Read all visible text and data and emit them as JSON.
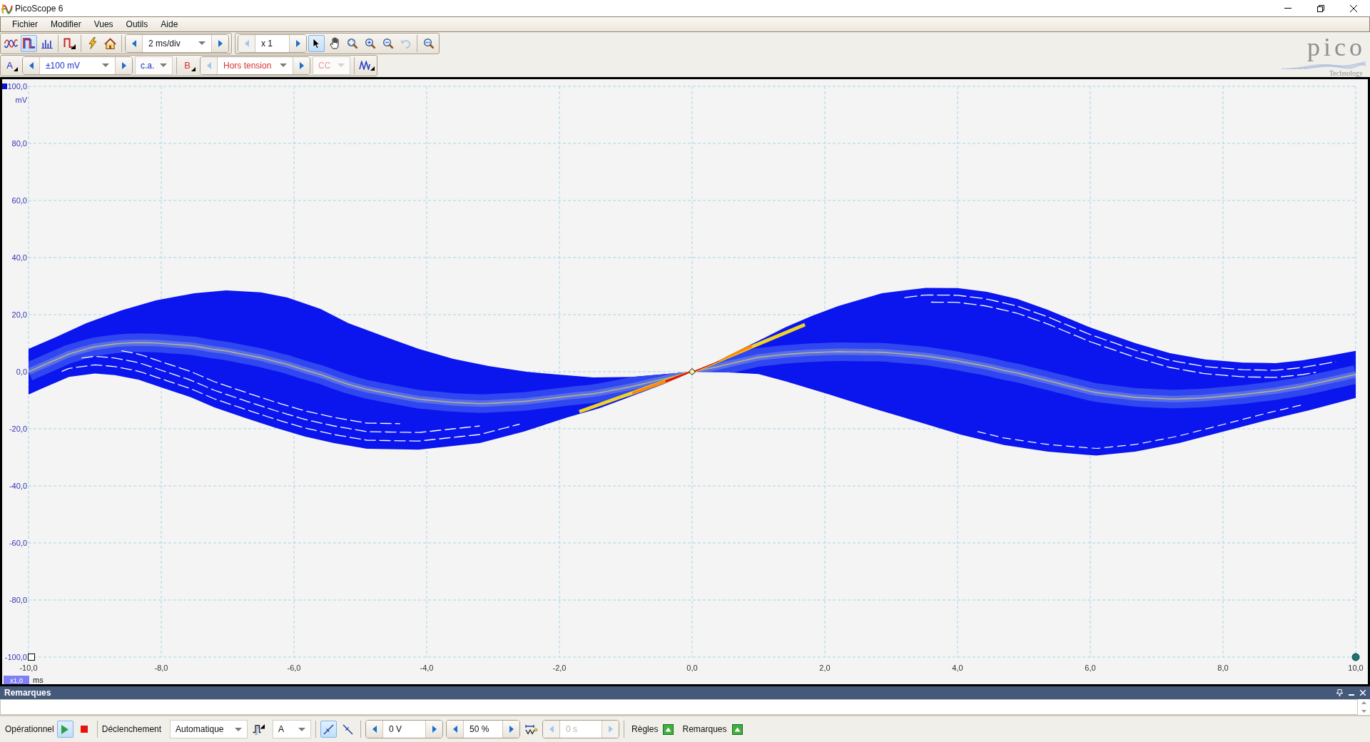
{
  "window": {
    "title": "PicoScope 6"
  },
  "menu": [
    "Fichier",
    "Modifier",
    "Vues",
    "Outils",
    "Aide"
  ],
  "toolbar": {
    "view_modes": [
      {
        "kind": "scope",
        "selected": false
      },
      {
        "kind": "persistence",
        "selected": true
      },
      {
        "kind": "spectrum",
        "selected": false
      }
    ],
    "timebase": "2 ms/div",
    "zoom_factor": {
      "value": "x 1",
      "decrease_disabled": true
    },
    "tools": [
      {
        "kind": "pointer",
        "selected": true,
        "disabled": false
      },
      {
        "kind": "hand",
        "selected": false,
        "disabled": false
      },
      {
        "kind": "zoom_region",
        "selected": false,
        "disabled": false
      },
      {
        "kind": "zoom_in",
        "selected": false,
        "disabled": false
      },
      {
        "kind": "zoom_out",
        "selected": false,
        "disabled": false
      },
      {
        "kind": "undo_zoom",
        "selected": false,
        "disabled": true
      }
    ]
  },
  "logo": {
    "wordmark": "pico",
    "tagline": "Technology"
  },
  "channels": [
    {
      "label": "A",
      "color": "#1f2fc8",
      "range": "±100 mV",
      "coupling": "c.a.",
      "enabled": true
    },
    {
      "label": "B",
      "color": "#d83232",
      "range": "Hors tension",
      "coupling": "CC",
      "enabled": false
    }
  ],
  "plot": {
    "y_labels": [
      "100,0",
      "80,0",
      "60,0",
      "40,0",
      "20,0",
      "0,0",
      "-20,0",
      "-40,0",
      "-60,0",
      "-80,0",
      "-100,0"
    ],
    "y_unit": "mV",
    "x_labels": [
      "-10,0",
      "-8,0",
      "-6,0",
      "-4,0",
      "-2,0",
      "0,0",
      "2,0",
      "4,0",
      "6,0",
      "8,0",
      "10,0"
    ],
    "x_unit": "ms",
    "zoom": "x1,0"
  },
  "notes_panel": {
    "title": "Remarques"
  },
  "status_bar": {
    "status": "Opérationnel",
    "run_controls": [
      {
        "kind": "run",
        "selected": true
      },
      {
        "kind": "stop",
        "selected": false
      }
    ],
    "trigger_label": "Déclenchement",
    "trigger_mode": "Automatique",
    "trigger_source": "A",
    "edges": [
      {
        "kind": "rising",
        "selected": true
      },
      {
        "kind": "falling",
        "selected": false
      }
    ],
    "threshold": "0 V",
    "pre_trigger": "50 %",
    "delay": {
      "value": "0 s",
      "disabled": true
    },
    "panel_toggles": [
      "Règles",
      "Remarques"
    ]
  }
}
